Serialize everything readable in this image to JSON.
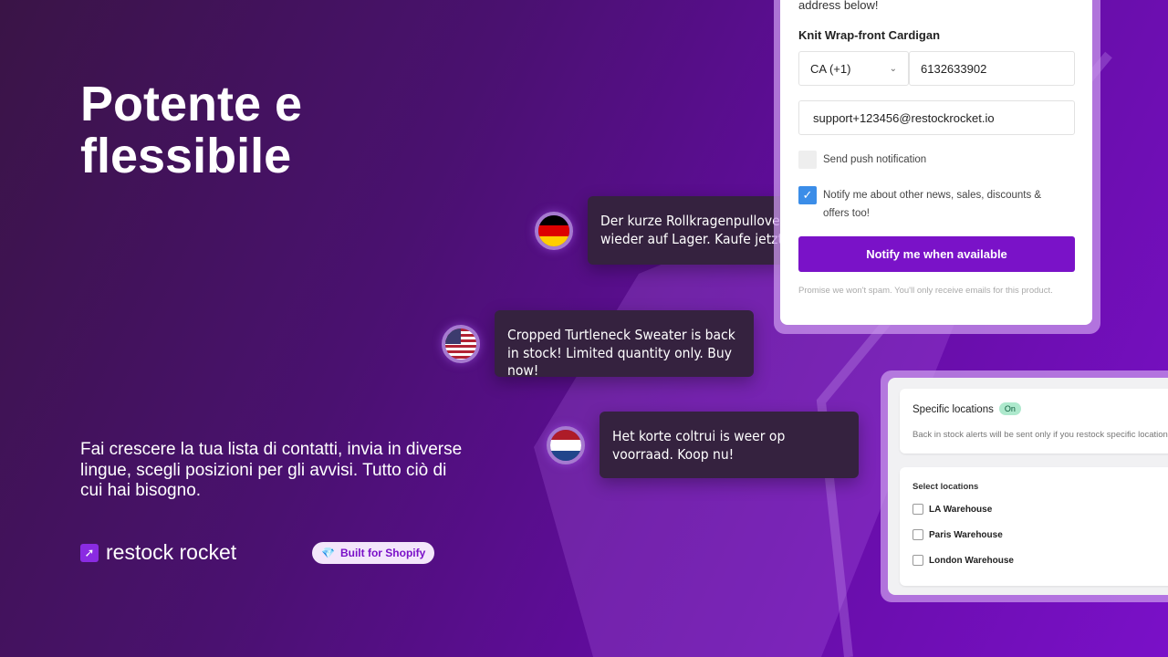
{
  "hero": {
    "title_line1": "Potente e",
    "title_line2": "flessibile",
    "subtitle": "Fai crescere la tua lista di contatti, invia in diverse lingue, scegli posizioni per gli avvisi. Tutto ciò di cui hai bisogno."
  },
  "brand": {
    "name": "restock rocket",
    "badge": "Built for Shopify"
  },
  "notifications": [
    {
      "flag": "germany",
      "text": "Der kurze Rollkragenpullover ist wieder auf Lager. Kaufe jetzt!"
    },
    {
      "flag": "usa",
      "text": "Cropped Turtleneck Sweater is back in stock! Limited quantity only. Buy now!"
    },
    {
      "flag": "netherlands",
      "text": "Het korte coltrui is weer op voorraad. Koop nu!"
    }
  ],
  "form": {
    "intro": "address below!",
    "product": "Knit Wrap-front Cardigan",
    "country": "CA (+1)",
    "phone": "6132633902",
    "email": "support+123456@restockrocket.io",
    "push_label": "Send push notification",
    "push_checked": false,
    "marketing_label": "Notify me about other news, sales, discounts & offers too!",
    "marketing_checked": true,
    "button": "Notify me when available",
    "note": "Promise we won't spam. You'll only receive emails for this product."
  },
  "locations": {
    "title": "Specific locations",
    "status": "On",
    "description": "Back in stock alerts will be sent only if you restock specific locations",
    "select_label": "Select locations",
    "items": [
      "LA Warehouse",
      "Paris Warehouse",
      "London Warehouse"
    ]
  },
  "colors": {
    "accent": "#7a12c8",
    "checkbox": "#3b8de8"
  }
}
